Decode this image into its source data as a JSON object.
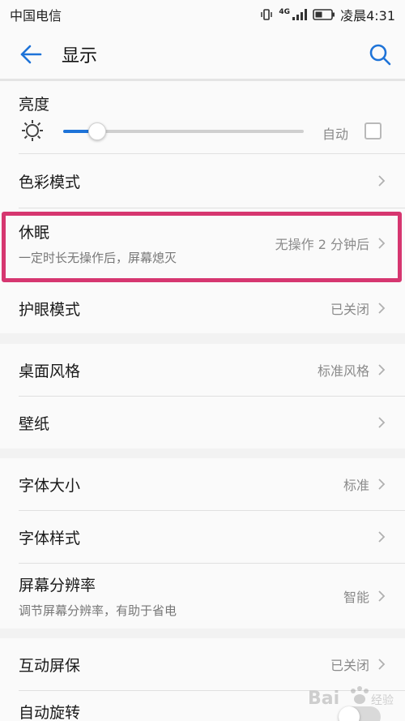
{
  "status_bar": {
    "carrier": "中国电信",
    "network": "4G",
    "time": "凌晨4:31",
    "icons": [
      "vibrate-icon",
      "signal-icon",
      "battery-icon"
    ]
  },
  "app_bar": {
    "title": "显示",
    "back_icon": "back-arrow-icon",
    "search_icon": "search-icon"
  },
  "brightness": {
    "label": "亮度",
    "level": 0.14,
    "auto_label": "自动",
    "auto_checked": false
  },
  "rows": {
    "color_mode": {
      "label": "色彩模式"
    },
    "sleep": {
      "label": "休眠",
      "sub": "一定时长无操作后，屏幕熄灭",
      "value": "无操作 2 分钟后"
    },
    "eye_comfort": {
      "label": "护眼模式",
      "value": "已关闭"
    },
    "home_style": {
      "label": "桌面风格",
      "value": "标准风格"
    },
    "wallpaper": {
      "label": "壁纸"
    },
    "font_size": {
      "label": "字体大小",
      "value": "标准"
    },
    "font_style": {
      "label": "字体样式"
    },
    "resolution": {
      "label": "屏幕分辨率",
      "sub": "调节屏幕分辨率，有助于省电",
      "value": "智能"
    },
    "screensaver": {
      "label": "互动屏保",
      "value": "已关闭"
    },
    "auto_rotate": {
      "label": "自动旋转",
      "enabled": false
    }
  },
  "colors": {
    "accent": "#1e73d8",
    "highlight": "#d63670",
    "background": "#f2f2f2",
    "card": "#fafafa"
  }
}
